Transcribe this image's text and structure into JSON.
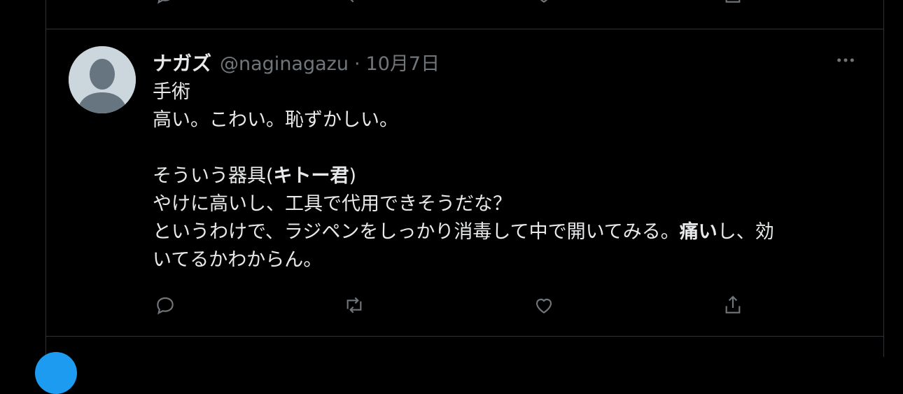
{
  "colors": {
    "background": "#000000",
    "text": "#e7e9ea",
    "secondary": "#71767b",
    "border": "#2f3336",
    "next_avatar": "#1d9bf0"
  },
  "tweet": {
    "display_name": "ナガズ",
    "handle": "@naginagazu",
    "separator": "·",
    "date": "10月7日",
    "avatar": "default-avatar",
    "lines": {
      "l1": "手術",
      "l2": "高い。こわい。恥ずかしい。",
      "l4a": "そういう器具(",
      "l4b": "キトー君",
      "l4c": ")",
      "l5": "やけに高いし、工具で代用できそうだな？",
      "l6a": "というわけで、ラジペンをしっかり消毒して中で開いてみる。",
      "l6b": "痛い",
      "l6c": "し、効",
      "l7": "いてるかわからん。"
    },
    "actions": [
      "reply-icon",
      "retweet-icon",
      "like-icon",
      "share-icon"
    ]
  }
}
